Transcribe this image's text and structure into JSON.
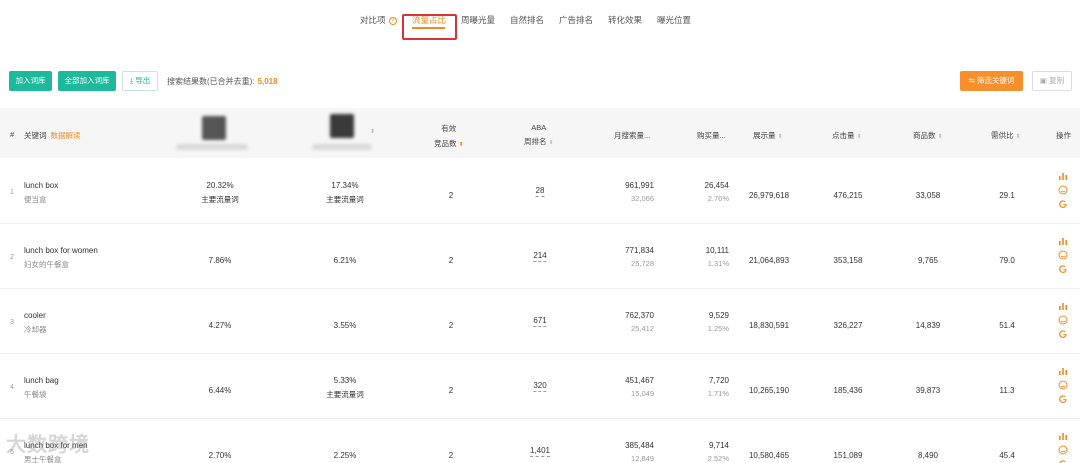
{
  "tabs": {
    "items": [
      {
        "label": "对比项",
        "has_help": true
      },
      {
        "label": "流量占比",
        "active": true
      },
      {
        "label": "周曝光量"
      },
      {
        "label": "自然排名"
      },
      {
        "label": "广告排名"
      },
      {
        "label": "转化效果"
      },
      {
        "label": "曝光位置"
      }
    ]
  },
  "toolbar": {
    "add_label": "加入词库",
    "add_all_label": "全部加入词库",
    "export_label": "导出",
    "result_label": "搜索结果数(已合并去重):",
    "result_count": "5,018",
    "filter_label": "筛选关键词",
    "copy_label": "复制"
  },
  "table": {
    "headers": {
      "num": "#",
      "keyword": "关键词",
      "keyword_extra": "数据解读",
      "effective_top": "有效",
      "effective_bottom": "竞品数",
      "aba_top": "ABA",
      "aba_bottom": "周排名",
      "monthly_search": "月搜索量...",
      "purchase": "购买量...",
      "impressions": "展示量",
      "clicks": "点击量",
      "products": "商品数",
      "supply_ratio": "需供比",
      "actions": "操作"
    },
    "rows": [
      {
        "num": "1",
        "keyword": "lunch box",
        "keyword_cn": "便当盒",
        "p1": "20.32%",
        "p1_tag": "主要流量词",
        "p2": "17.34%",
        "p2_tag": "主要流量词",
        "effective": "2",
        "aba": "28",
        "monthly": "961,991",
        "monthly_sub": "32,066",
        "purchase": "26,454",
        "purchase_sub": "2.76%",
        "impressions": "26,979,618",
        "clicks": "476,215",
        "products": "33,058",
        "ratio": "29.1"
      },
      {
        "num": "2",
        "keyword": "lunch box for women",
        "keyword_cn": "妇女的午餐盒",
        "p1": "7.86%",
        "p1_tag": "",
        "p2": "6.21%",
        "p2_tag": "",
        "effective": "2",
        "aba": "214",
        "monthly": "771,834",
        "monthly_sub": "25,728",
        "purchase": "10,111",
        "purchase_sub": "1.31%",
        "impressions": "21,064,893",
        "clicks": "353,158",
        "products": "9,765",
        "ratio": "79.0"
      },
      {
        "num": "3",
        "keyword": "cooler",
        "keyword_cn": "冷却器",
        "p1": "4.27%",
        "p1_tag": "",
        "p2": "3.55%",
        "p2_tag": "",
        "effective": "2",
        "aba": "671",
        "monthly": "762,370",
        "monthly_sub": "25,412",
        "purchase": "9,529",
        "purchase_sub": "1.25%",
        "impressions": "18,830,591",
        "clicks": "326,227",
        "products": "14,839",
        "ratio": "51.4"
      },
      {
        "num": "4",
        "keyword": "lunch bag",
        "keyword_cn": "午餐袋",
        "p1": "6.44%",
        "p1_tag": "",
        "p2": "5.33%",
        "p2_tag": "主要流量词",
        "effective": "2",
        "aba": "320",
        "monthly": "451,467",
        "monthly_sub": "15,049",
        "purchase": "7,720",
        "purchase_sub": "1.71%",
        "impressions": "10,265,190",
        "clicks": "185,436",
        "products": "39,873",
        "ratio": "11.3"
      },
      {
        "num": "5",
        "keyword": "lunch box for men",
        "keyword_cn": "男士午餐盒",
        "p1": "2.70%",
        "p1_tag": "",
        "p2": "2.25%",
        "p2_tag": "",
        "effective": "2",
        "aba": "1,401",
        "monthly": "385,484",
        "monthly_sub": "12,849",
        "purchase": "9,714",
        "purchase_sub": "2.52%",
        "impressions": "10,580,465",
        "clicks": "151,089",
        "products": "8,490",
        "ratio": "45.4"
      }
    ]
  },
  "watermark": "大数跨境",
  "colors": {
    "accent": "#f08a24",
    "green": "#1db99a",
    "red_box": "#d9333a"
  }
}
